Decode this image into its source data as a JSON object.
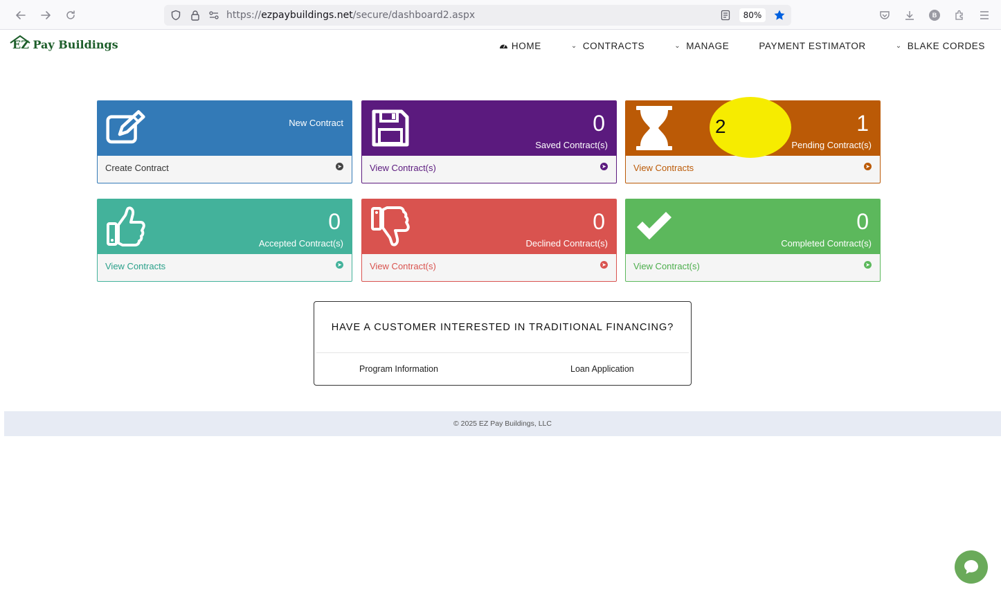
{
  "browser": {
    "url_prefix": "https://",
    "url_host": "ezpaybuildings.net",
    "url_path": "/secure/dashboard2.aspx",
    "zoom": "80%",
    "profile_initial": "B"
  },
  "header": {
    "logo_text": "EZ Pay Buildings",
    "nav": {
      "home": "HOME",
      "contracts": "CONTRACTS",
      "manage": "MANAGE",
      "payment_estimator": "PAYMENT ESTIMATOR",
      "user": "BLAKE CORDES"
    }
  },
  "tiles": {
    "new": {
      "caption": "New Contract",
      "link": "Create Contract",
      "color": "#337ab7",
      "icon": "pencil-square-icon"
    },
    "saved": {
      "count": "0",
      "caption": "Saved Contract(s)",
      "link": "View Contract(s)",
      "color": "#5b1a7e",
      "icon": "floppy-disk-icon"
    },
    "pending": {
      "count": "1",
      "caption": "Pending Contract(s)",
      "link": "View Contracts",
      "color": "#bb5a06",
      "icon": "hourglass-icon"
    },
    "accepted": {
      "count": "0",
      "caption": "Accepted Contract(s)",
      "link": "View Contracts",
      "color": "#43b29b",
      "icon": "thumbs-up-icon"
    },
    "declined": {
      "count": "0",
      "caption": "Declined Contract(s)",
      "link": "View Contract(s)",
      "color": "#d9534f",
      "icon": "thumbs-down-icon"
    },
    "completed": {
      "count": "0",
      "caption": "Completed Contract(s)",
      "link": "View Contract(s)",
      "color": "#5cb85c",
      "icon": "checkmark-icon"
    }
  },
  "annotation": {
    "label": "2",
    "color": "#f6ec00"
  },
  "financing": {
    "title": "HAVE A CUSTOMER INTERESTED IN TRADITIONAL FINANCING?",
    "program_info": "Program Information",
    "loan_application": "Loan Application"
  },
  "footer": {
    "copyright": "© 2025 EZ Pay Buildings, LLC"
  }
}
